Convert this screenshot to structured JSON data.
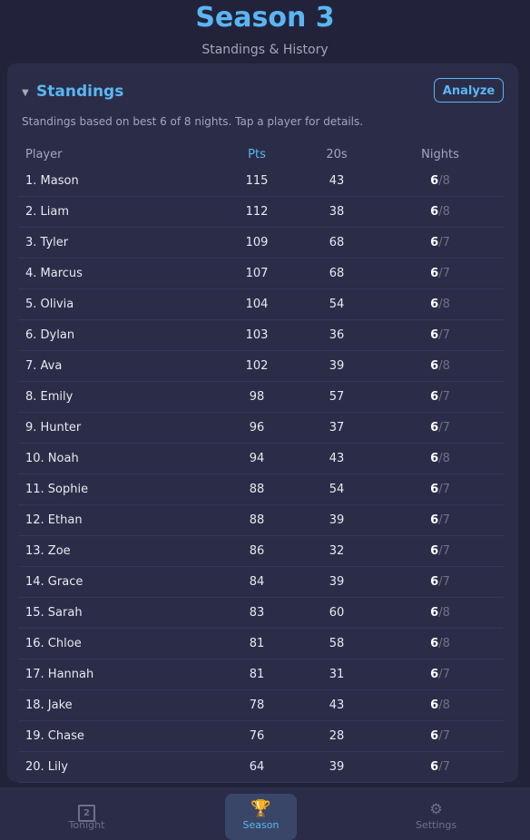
{
  "header": {
    "title": "Season 3",
    "subtitle": "Standings & History"
  },
  "card": {
    "title": "Standings",
    "analyze_label": "Analyze",
    "note": "Standings based on best 6 of 8 nights. Tap a player for details."
  },
  "table": {
    "columns": [
      "Player",
      "Pts",
      "20s",
      "Nights"
    ],
    "rows": [
      {
        "player": "1. Mason",
        "pts": "115",
        "twenties": "43",
        "counted": "6",
        "total": "/8"
      },
      {
        "player": "2. Liam",
        "pts": "112",
        "twenties": "38",
        "counted": "6",
        "total": "/8"
      },
      {
        "player": "3. Tyler",
        "pts": "109",
        "twenties": "68",
        "counted": "6",
        "total": "/7"
      },
      {
        "player": "4. Marcus",
        "pts": "107",
        "twenties": "68",
        "counted": "6",
        "total": "/7"
      },
      {
        "player": "5. Olivia",
        "pts": "104",
        "twenties": "54",
        "counted": "6",
        "total": "/8"
      },
      {
        "player": "6. Dylan",
        "pts": "103",
        "twenties": "36",
        "counted": "6",
        "total": "/7"
      },
      {
        "player": "7. Ava",
        "pts": "102",
        "twenties": "39",
        "counted": "6",
        "total": "/8"
      },
      {
        "player": "8. Emily",
        "pts": "98",
        "twenties": "57",
        "counted": "6",
        "total": "/7"
      },
      {
        "player": "9. Hunter",
        "pts": "96",
        "twenties": "37",
        "counted": "6",
        "total": "/7"
      },
      {
        "player": "10. Noah",
        "pts": "94",
        "twenties": "43",
        "counted": "6",
        "total": "/8"
      },
      {
        "player": "11. Sophie",
        "pts": "88",
        "twenties": "54",
        "counted": "6",
        "total": "/7"
      },
      {
        "player": "12. Ethan",
        "pts": "88",
        "twenties": "39",
        "counted": "6",
        "total": "/7"
      },
      {
        "player": "13. Zoe",
        "pts": "86",
        "twenties": "32",
        "counted": "6",
        "total": "/7"
      },
      {
        "player": "14. Grace",
        "pts": "84",
        "twenties": "39",
        "counted": "6",
        "total": "/7"
      },
      {
        "player": "15. Sarah",
        "pts": "83",
        "twenties": "60",
        "counted": "6",
        "total": "/8"
      },
      {
        "player": "16. Chloe",
        "pts": "81",
        "twenties": "58",
        "counted": "6",
        "total": "/8"
      },
      {
        "player": "17. Hannah",
        "pts": "81",
        "twenties": "31",
        "counted": "6",
        "total": "/7"
      },
      {
        "player": "18. Jake",
        "pts": "78",
        "twenties": "43",
        "counted": "6",
        "total": "/8"
      },
      {
        "player": "19. Chase",
        "pts": "76",
        "twenties": "28",
        "counted": "6",
        "total": "/7"
      },
      {
        "player": "20. Lily",
        "pts": "64",
        "twenties": "39",
        "counted": "6",
        "total": "/7"
      }
    ]
  },
  "tabbar": {
    "tabs": [
      {
        "label": "Tonight",
        "icon": "calendar-icon",
        "badge": "2"
      },
      {
        "label": "Season",
        "icon": "trophy-icon",
        "glyph": "🏆"
      },
      {
        "label": "Settings",
        "icon": "gear-icon",
        "glyph": "⚙"
      }
    ]
  },
  "colors": {
    "accent": "#5ab6f2",
    "background": "#22233a",
    "card": "#2b2d48",
    "active_tab": "#3a4667"
  }
}
